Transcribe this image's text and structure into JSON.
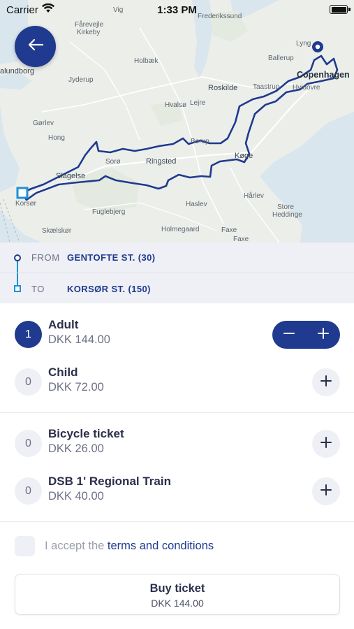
{
  "status_bar": {
    "carrier": "Carrier",
    "time": "1:33 PM"
  },
  "map": {
    "labels": {
      "vig": "Vig",
      "fredrikssund": "Frederikssund",
      "faarevejle": "Fårevejle",
      "kirkeby": "Kirkeby",
      "lyngby": "Lyng",
      "ballerup": "Ballerup",
      "kalundborg": "alundborg",
      "holbaek": "Holbæk",
      "jyderup": "Jyderup",
      "copenhagen": "Copenhagen",
      "roskilde": "Roskilde",
      "taastrup": "Taastrup",
      "hvidovre": "Hvidovre",
      "hvalso": "Hvalsø",
      "lejre": "Lejre",
      "gorlev": "Gørlev",
      "hong": "Hong",
      "borup": "Borup",
      "soro": "Sorø",
      "ringsted": "Ringsted",
      "koge": "Køge",
      "slagelse": "Slagelse",
      "korsor": "Korsør",
      "fuglebjerg": "Fuglebjerg",
      "haslev": "Haslev",
      "harlev": "Hårlev",
      "store": "Store",
      "heddinge": "Heddinge",
      "skaelskor": "Skælskør",
      "holmegaard": "Holmegaard",
      "faxe": "Faxe",
      "faxe2": "Faxe"
    }
  },
  "route": {
    "from_label": "FROM",
    "from_station": "GENTOFTE ST. (30)",
    "to_label": "TO",
    "to_station": "KORSØR ST. (150)"
  },
  "tickets": [
    {
      "name": "Adult",
      "price": "DKK 144.00",
      "count": "1"
    },
    {
      "name": "Child",
      "price": "DKK 72.00",
      "count": "0"
    }
  ],
  "extras": [
    {
      "name": "Bicycle ticket",
      "price": "DKK 26.00",
      "count": "0"
    },
    {
      "name": "DSB 1' Regional Train",
      "price": "DKK 40.00",
      "count": "0"
    }
  ],
  "terms": {
    "prefix": "I accept the ",
    "link": "terms and conditions"
  },
  "buy": {
    "label": "Buy ticket",
    "price": "DKK 144.00"
  },
  "colors": {
    "accent": "#1f3a8f",
    "route_blue": "#1e90d6",
    "chip_bg": "#eef0f5"
  },
  "icons": [
    "wifi-icon",
    "battery-icon",
    "back-arrow-icon",
    "minus-icon",
    "plus-icon",
    "checkbox-icon",
    "route-line-icon"
  ]
}
